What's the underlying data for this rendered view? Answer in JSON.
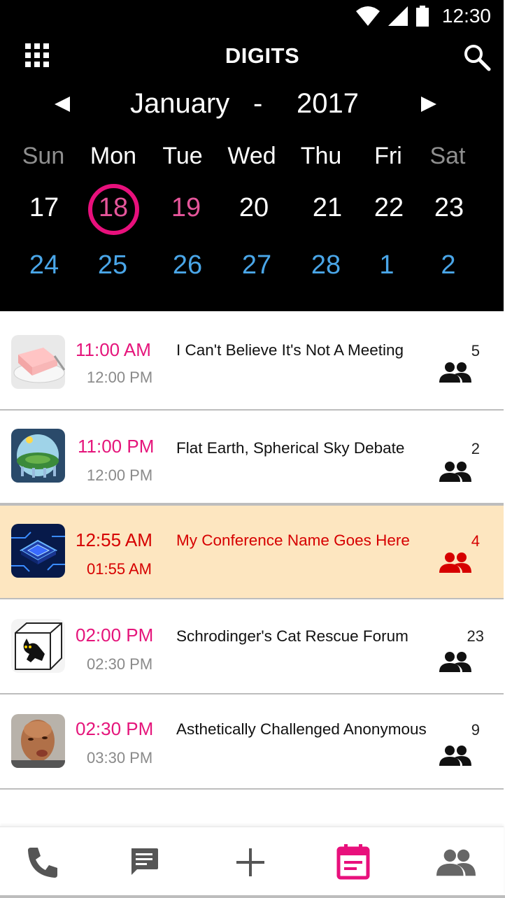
{
  "status_bar": {
    "time": "12:30",
    "icons": [
      "wifi-icon",
      "signal-icon",
      "battery-icon"
    ]
  },
  "app": {
    "title": "DIGITS",
    "menu_icon": "apps-grid-icon",
    "search_icon": "search-icon"
  },
  "calendar": {
    "month": "January",
    "separator": "-",
    "year": "2017",
    "weekdays": [
      "Sun",
      "Mon",
      "Tue",
      "Wed",
      "Thu",
      "Fri",
      "Sat"
    ],
    "weeks": [
      [
        "17",
        "18",
        "19",
        "20",
        "21",
        "22",
        "23"
      ],
      [
        "24",
        "25",
        "26",
        "27",
        "28",
        "1",
        "2"
      ]
    ],
    "selected_day": "18"
  },
  "events": [
    {
      "start": "11:00 AM",
      "end": "12:00 PM",
      "title": "I Can't Believe It's Not A Meeting",
      "count": "5",
      "thumb": "butter-thumbnail",
      "highlighted": false
    },
    {
      "start": "11:00 PM",
      "end": "12:00 PM",
      "title": "Flat Earth, Spherical Sky Debate",
      "count": "2",
      "thumb": "flat-earth-thumbnail",
      "highlighted": false
    },
    {
      "start": "12:55 AM",
      "end": "01:55 AM",
      "title": "My Conference Name Goes Here",
      "count": "4",
      "thumb": "circuit-chip-thumbnail",
      "highlighted": true
    },
    {
      "start": "02:00 PM",
      "end": "02:30 PM",
      "title": "Schrodinger's Cat Rescue Forum",
      "count": "23",
      "thumb": "cat-box-thumbnail",
      "highlighted": false
    },
    {
      "start": "02:30 PM",
      "end": "03:30 PM",
      "title": "Asthetically Challenged Anonymous",
      "count": "9",
      "thumb": "face-photo-thumbnail",
      "highlighted": false
    }
  ],
  "bottom_nav": [
    {
      "icon": "phone-icon",
      "active": false
    },
    {
      "icon": "chat-icon",
      "active": false
    },
    {
      "icon": "add-icon",
      "active": false
    },
    {
      "icon": "calendar-icon",
      "active": true
    },
    {
      "icon": "contacts-icon",
      "active": false
    }
  ],
  "colors": {
    "accent": "#e8107c",
    "header_bg": "#000000",
    "next_week": "#4aa6e8",
    "highlight_bg": "#fde6c0",
    "highlight_text": "#d60000",
    "weekend": "#8f8f8f"
  }
}
